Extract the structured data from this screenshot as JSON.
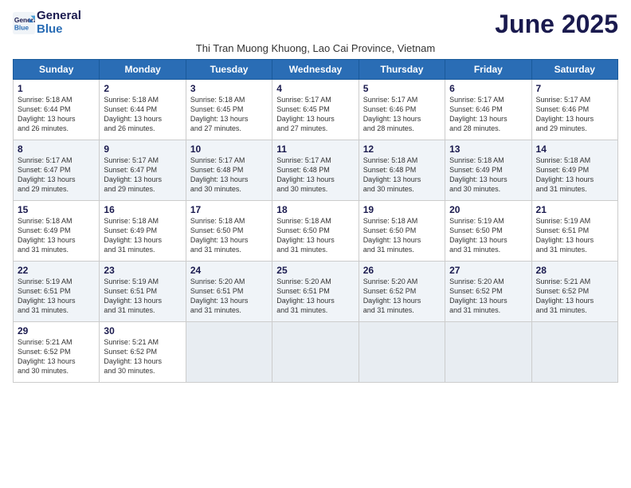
{
  "logo": {
    "line1": "General",
    "line2": "Blue"
  },
  "title": "June 2025",
  "subtitle": "Thi Tran Muong Khuong, Lao Cai Province, Vietnam",
  "days_of_week": [
    "Sunday",
    "Monday",
    "Tuesday",
    "Wednesday",
    "Thursday",
    "Friday",
    "Saturday"
  ],
  "weeks": [
    [
      {
        "day": "1",
        "info": "Sunrise: 5:18 AM\nSunset: 6:44 PM\nDaylight: 13 hours\nand 26 minutes."
      },
      {
        "day": "2",
        "info": "Sunrise: 5:18 AM\nSunset: 6:44 PM\nDaylight: 13 hours\nand 26 minutes."
      },
      {
        "day": "3",
        "info": "Sunrise: 5:18 AM\nSunset: 6:45 PM\nDaylight: 13 hours\nand 27 minutes."
      },
      {
        "day": "4",
        "info": "Sunrise: 5:17 AM\nSunset: 6:45 PM\nDaylight: 13 hours\nand 27 minutes."
      },
      {
        "day": "5",
        "info": "Sunrise: 5:17 AM\nSunset: 6:46 PM\nDaylight: 13 hours\nand 28 minutes."
      },
      {
        "day": "6",
        "info": "Sunrise: 5:17 AM\nSunset: 6:46 PM\nDaylight: 13 hours\nand 28 minutes."
      },
      {
        "day": "7",
        "info": "Sunrise: 5:17 AM\nSunset: 6:46 PM\nDaylight: 13 hours\nand 29 minutes."
      }
    ],
    [
      {
        "day": "8",
        "info": "Sunrise: 5:17 AM\nSunset: 6:47 PM\nDaylight: 13 hours\nand 29 minutes."
      },
      {
        "day": "9",
        "info": "Sunrise: 5:17 AM\nSunset: 6:47 PM\nDaylight: 13 hours\nand 29 minutes."
      },
      {
        "day": "10",
        "info": "Sunrise: 5:17 AM\nSunset: 6:48 PM\nDaylight: 13 hours\nand 30 minutes."
      },
      {
        "day": "11",
        "info": "Sunrise: 5:17 AM\nSunset: 6:48 PM\nDaylight: 13 hours\nand 30 minutes."
      },
      {
        "day": "12",
        "info": "Sunrise: 5:18 AM\nSunset: 6:48 PM\nDaylight: 13 hours\nand 30 minutes."
      },
      {
        "day": "13",
        "info": "Sunrise: 5:18 AM\nSunset: 6:49 PM\nDaylight: 13 hours\nand 30 minutes."
      },
      {
        "day": "14",
        "info": "Sunrise: 5:18 AM\nSunset: 6:49 PM\nDaylight: 13 hours\nand 31 minutes."
      }
    ],
    [
      {
        "day": "15",
        "info": "Sunrise: 5:18 AM\nSunset: 6:49 PM\nDaylight: 13 hours\nand 31 minutes."
      },
      {
        "day": "16",
        "info": "Sunrise: 5:18 AM\nSunset: 6:49 PM\nDaylight: 13 hours\nand 31 minutes."
      },
      {
        "day": "17",
        "info": "Sunrise: 5:18 AM\nSunset: 6:50 PM\nDaylight: 13 hours\nand 31 minutes."
      },
      {
        "day": "18",
        "info": "Sunrise: 5:18 AM\nSunset: 6:50 PM\nDaylight: 13 hours\nand 31 minutes."
      },
      {
        "day": "19",
        "info": "Sunrise: 5:18 AM\nSunset: 6:50 PM\nDaylight: 13 hours\nand 31 minutes."
      },
      {
        "day": "20",
        "info": "Sunrise: 5:19 AM\nSunset: 6:50 PM\nDaylight: 13 hours\nand 31 minutes."
      },
      {
        "day": "21",
        "info": "Sunrise: 5:19 AM\nSunset: 6:51 PM\nDaylight: 13 hours\nand 31 minutes."
      }
    ],
    [
      {
        "day": "22",
        "info": "Sunrise: 5:19 AM\nSunset: 6:51 PM\nDaylight: 13 hours\nand 31 minutes."
      },
      {
        "day": "23",
        "info": "Sunrise: 5:19 AM\nSunset: 6:51 PM\nDaylight: 13 hours\nand 31 minutes."
      },
      {
        "day": "24",
        "info": "Sunrise: 5:20 AM\nSunset: 6:51 PM\nDaylight: 13 hours\nand 31 minutes."
      },
      {
        "day": "25",
        "info": "Sunrise: 5:20 AM\nSunset: 6:51 PM\nDaylight: 13 hours\nand 31 minutes."
      },
      {
        "day": "26",
        "info": "Sunrise: 5:20 AM\nSunset: 6:52 PM\nDaylight: 13 hours\nand 31 minutes."
      },
      {
        "day": "27",
        "info": "Sunrise: 5:20 AM\nSunset: 6:52 PM\nDaylight: 13 hours\nand 31 minutes."
      },
      {
        "day": "28",
        "info": "Sunrise: 5:21 AM\nSunset: 6:52 PM\nDaylight: 13 hours\nand 31 minutes."
      }
    ],
    [
      {
        "day": "29",
        "info": "Sunrise: 5:21 AM\nSunset: 6:52 PM\nDaylight: 13 hours\nand 30 minutes."
      },
      {
        "day": "30",
        "info": "Sunrise: 5:21 AM\nSunset: 6:52 PM\nDaylight: 13 hours\nand 30 minutes."
      },
      {
        "day": "",
        "info": ""
      },
      {
        "day": "",
        "info": ""
      },
      {
        "day": "",
        "info": ""
      },
      {
        "day": "",
        "info": ""
      },
      {
        "day": "",
        "info": ""
      }
    ]
  ]
}
